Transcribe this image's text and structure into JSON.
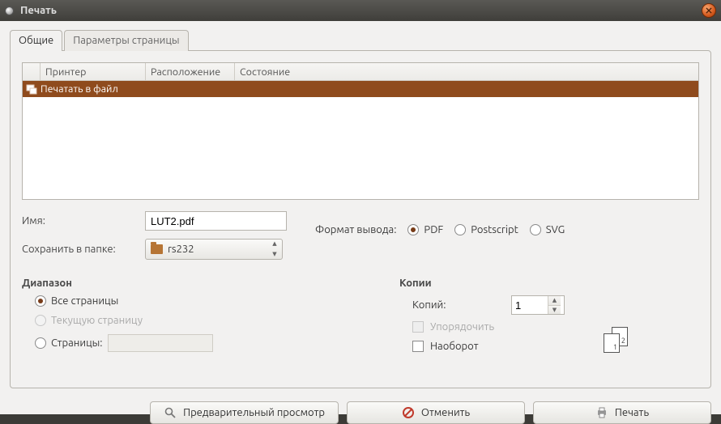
{
  "window": {
    "title": "Печать"
  },
  "tabs": {
    "general": "Общие",
    "page_setup": "Параметры страницы"
  },
  "table": {
    "headers": {
      "printer": "Принтер",
      "location": "Расположение",
      "status": "Состояние"
    },
    "rows": [
      {
        "name": "Печатать в файл",
        "location": "",
        "status": ""
      }
    ]
  },
  "name_label": "Имя:",
  "name_value": "LUT2.pdf",
  "save_folder_label": "Сохранить в папке:",
  "save_folder_value": "rs232",
  "format_label": "Формат вывода:",
  "format_options": {
    "pdf": "PDF",
    "ps": "Postscript",
    "svg": "SVG"
  },
  "range": {
    "title": "Диапазон",
    "all": "Все страницы",
    "current": "Текущую страницу",
    "pages": "Страницы:"
  },
  "copies": {
    "title": "Копии",
    "count_label": "Копий:",
    "count_value": "1",
    "collate": "Упорядочить",
    "reverse": "Наоборот"
  },
  "buttons": {
    "preview": "Предварительный просмотр",
    "cancel": "Отменить",
    "print": "Печать"
  }
}
